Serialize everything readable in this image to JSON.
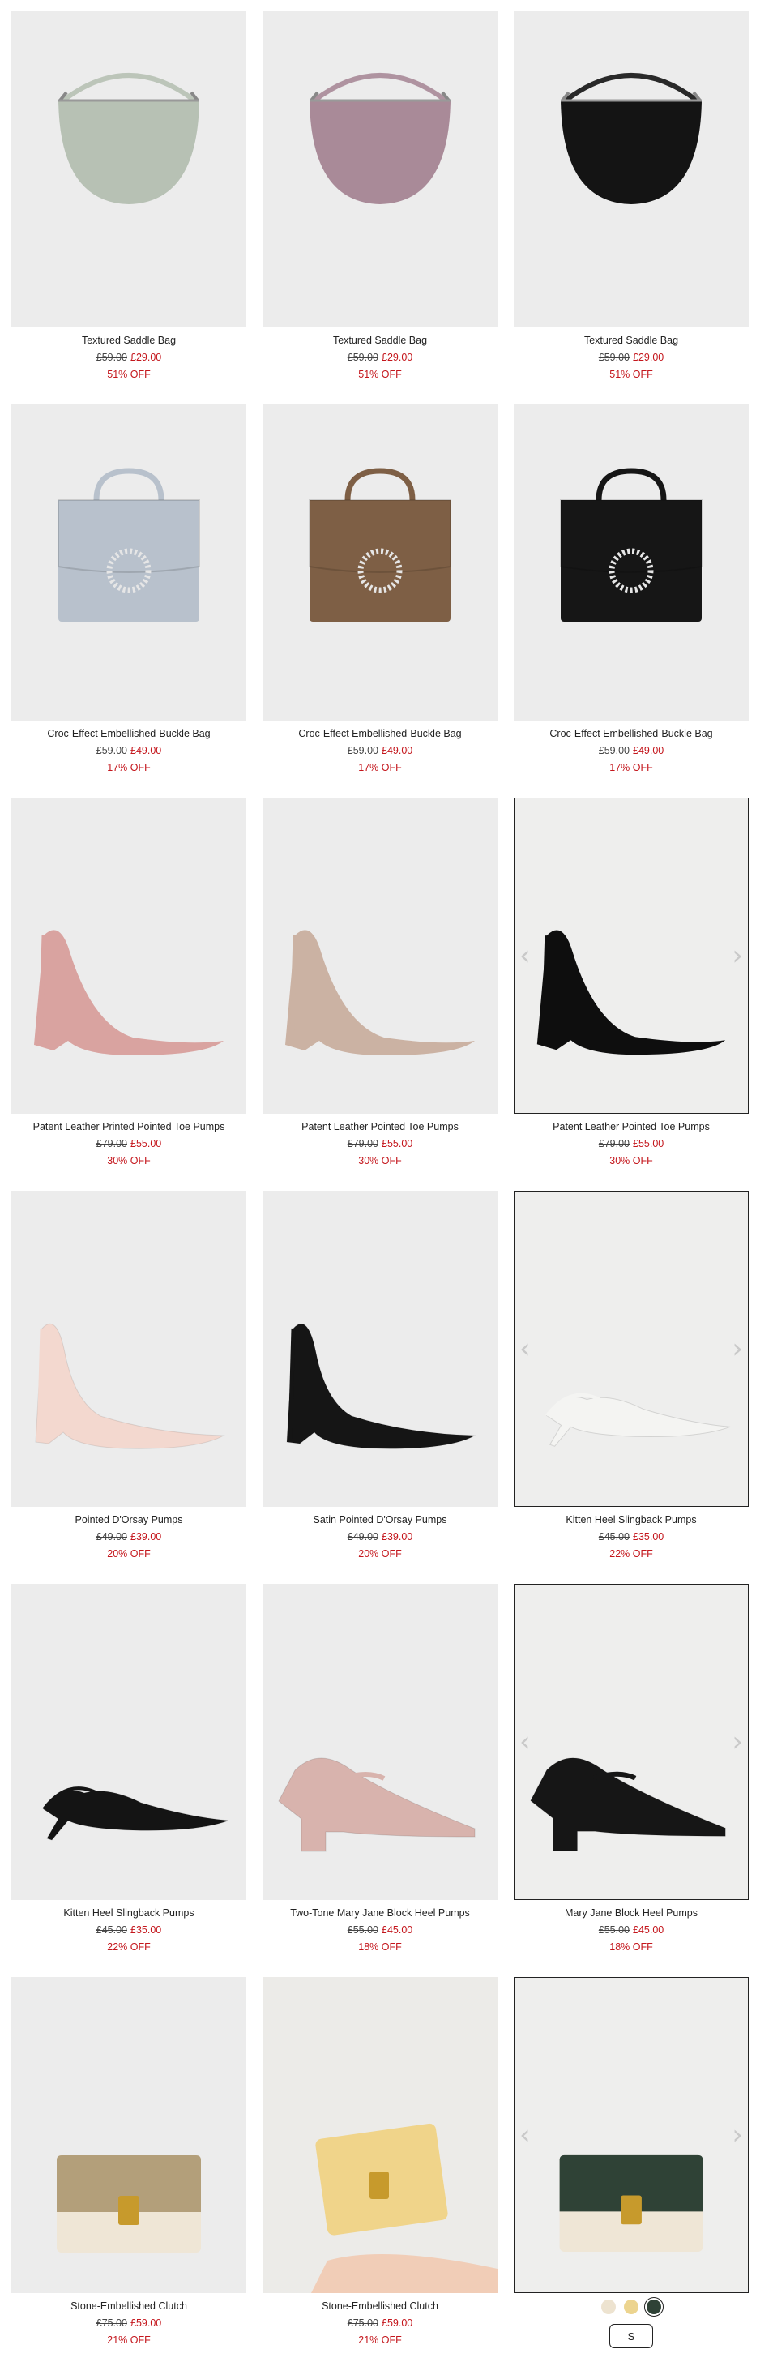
{
  "products": [
    {
      "name": "Textured Saddle Bag",
      "original_price": "£59.00",
      "sale_price": "£29.00",
      "discount": "51% OFF",
      "icon": "saddle-bag",
      "color": "#b7c1b4",
      "active": false
    },
    {
      "name": "Textured Saddle Bag",
      "original_price": "£59.00",
      "sale_price": "£29.00",
      "discount": "51% OFF",
      "icon": "saddle-bag",
      "color": "#a98a98",
      "active": false
    },
    {
      "name": "Textured Saddle Bag",
      "original_price": "£59.00",
      "sale_price": "£29.00",
      "discount": "51% OFF",
      "icon": "saddle-bag",
      "color": "#141414",
      "active": false
    },
    {
      "name": "Croc-Effect Embellished-Buckle Bag",
      "original_price": "£59.00",
      "sale_price": "£49.00",
      "discount": "17% OFF",
      "icon": "top-handle-bag",
      "color": "#b8c1cc",
      "active": false
    },
    {
      "name": "Croc-Effect Embellished-Buckle Bag",
      "original_price": "£59.00",
      "sale_price": "£49.00",
      "discount": "17% OFF",
      "icon": "top-handle-bag",
      "color": "#7e5f45",
      "active": false
    },
    {
      "name": "Croc-Effect Embellished-Buckle Bag",
      "original_price": "£59.00",
      "sale_price": "£49.00",
      "discount": "17% OFF",
      "icon": "top-handle-bag",
      "color": "#161616",
      "active": false
    },
    {
      "name": "Patent Leather Printed Pointed Toe Pumps",
      "original_price": "£79.00",
      "sale_price": "£55.00",
      "discount": "30% OFF",
      "icon": "pump",
      "color": "#d9a3a0",
      "active": false
    },
    {
      "name": "Patent Leather Pointed Toe Pumps",
      "original_price": "£79.00",
      "sale_price": "£55.00",
      "discount": "30% OFF",
      "icon": "pump",
      "color": "#cbb2a3",
      "active": false
    },
    {
      "name": "Patent Leather Pointed Toe Pumps",
      "original_price": "£79.00",
      "sale_price": "£55.00",
      "discount": "30% OFF",
      "icon": "pump",
      "color": "#0e0e0e",
      "active": true
    },
    {
      "name": "Pointed D'Orsay Pumps",
      "original_price": "£49.00",
      "sale_price": "£39.00",
      "discount": "20% OFF",
      "icon": "dorsay",
      "color": "#f3d8cf",
      "active": false
    },
    {
      "name": "Satin Pointed D'Orsay Pumps",
      "original_price": "£49.00",
      "sale_price": "£39.00",
      "discount": "20% OFF",
      "icon": "dorsay",
      "color": "#151515",
      "active": false
    },
    {
      "name": "Kitten Heel Slingback Pumps",
      "original_price": "£45.00",
      "sale_price": "£35.00",
      "discount": "22% OFF",
      "icon": "slingback",
      "color": "#f4f4f2",
      "active": true
    },
    {
      "name": "Kitten Heel Slingback Pumps",
      "original_price": "£45.00",
      "sale_price": "£35.00",
      "discount": "22% OFF",
      "icon": "slingback",
      "color": "#141414",
      "active": false
    },
    {
      "name": "Two-Tone Mary Jane Block Heel Pumps",
      "original_price": "£55.00",
      "sale_price": "£45.00",
      "discount": "18% OFF",
      "icon": "maryjane",
      "color": "#d8b3ad",
      "active": false
    },
    {
      "name": "Mary Jane Block Heel Pumps",
      "original_price": "£55.00",
      "sale_price": "£45.00",
      "discount": "18% OFF",
      "icon": "maryjane",
      "color": "#161616",
      "active": true
    },
    {
      "name": "Stone-Embellished Clutch",
      "original_price": "£75.00",
      "sale_price": "£59.00",
      "discount": "21% OFF",
      "icon": "clutch",
      "color": "#b39f7a",
      "active": false
    },
    {
      "name": "Stone-Embellished Clutch",
      "original_price": "£75.00",
      "sale_price": "£59.00",
      "discount": "21% OFF",
      "icon": "clutch-hand",
      "color": "#f0d48a",
      "active": false
    },
    {
      "name": "",
      "original_price": "",
      "sale_price": "",
      "discount": "",
      "icon": "clutch",
      "color": "#2f4236",
      "active": true,
      "swatches": [
        "#ede3d0",
        "#ecd48f",
        "#2f4236"
      ],
      "selected_swatch": 2,
      "size_label": "S"
    }
  ],
  "carousel": {
    "prev_icon": "‹",
    "next_icon": "›"
  },
  "colors": {
    "sale": "#c4161c",
    "card_bg": "#ececec"
  }
}
